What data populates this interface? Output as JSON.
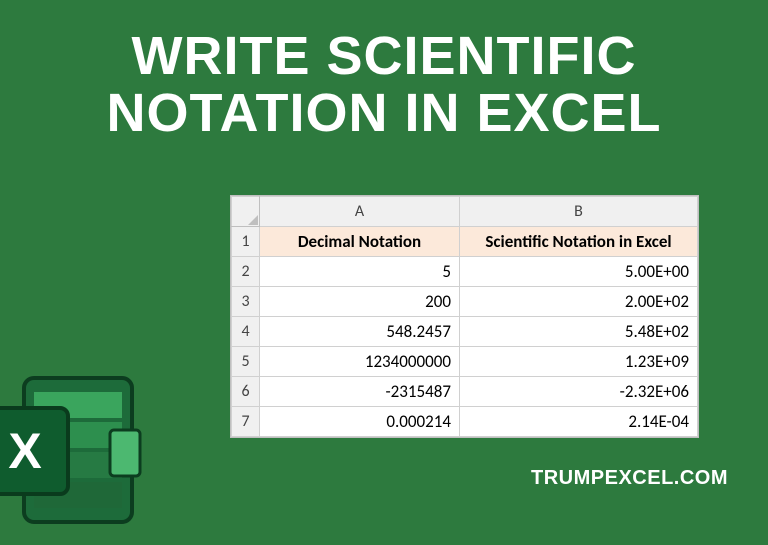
{
  "title_line1": "WRITE SCIENTIFIC",
  "title_line2": "NOTATION IN EXCEL",
  "footer": "TRUMPEXCEL.COM",
  "columns": {
    "letter_a": "A",
    "letter_b": "B"
  },
  "rows": {
    "r1": "1",
    "r2": "2",
    "r3": "3",
    "r4": "4",
    "r5": "5",
    "r6": "6",
    "r7": "7"
  },
  "headers": {
    "a": "Decimal Notation",
    "b": "Scientific Notation in Excel"
  },
  "data": {
    "r2": {
      "a": "5",
      "b": "5.00E+00"
    },
    "r3": {
      "a": "200",
      "b": "2.00E+02"
    },
    "r4": {
      "a": "548.2457",
      "b": "5.48E+02"
    },
    "r5": {
      "a": "1234000000",
      "b": "1.23E+09"
    },
    "r6": {
      "a": "-2315487",
      "b": "-2.32E+06"
    },
    "r7": {
      "a": "0.000214",
      "b": "2.14E-04"
    }
  },
  "chart_data": {
    "type": "table",
    "title": "Write Scientific Notation in Excel",
    "columns": [
      "Decimal Notation",
      "Scientific Notation in Excel"
    ],
    "rows": [
      {
        "decimal": 5,
        "scientific": "5.00E+00"
      },
      {
        "decimal": 200,
        "scientific": "2.00E+02"
      },
      {
        "decimal": 548.2457,
        "scientific": "5.48E+02"
      },
      {
        "decimal": 1234000000,
        "scientific": "1.23E+09"
      },
      {
        "decimal": -2315487,
        "scientific": "-2.32E+06"
      },
      {
        "decimal": 0.000214,
        "scientific": "2.14E-04"
      }
    ]
  }
}
